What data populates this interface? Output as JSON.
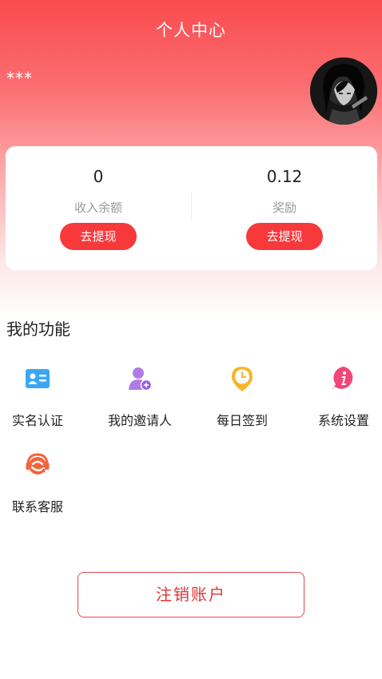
{
  "header": {
    "title": "个人中心",
    "username": "***"
  },
  "balance": {
    "income": {
      "value": "0",
      "label": "收入余额",
      "button": "去提现"
    },
    "reward": {
      "value": "0.12",
      "label": "奖励",
      "button": "去提现"
    }
  },
  "functions": {
    "section_title": "我的功能",
    "items": [
      {
        "label": "实名认证",
        "icon": "id-card-icon",
        "color": "#3aa7f5"
      },
      {
        "label": "我的邀请人",
        "icon": "inviter-icon",
        "color": "#b07be6"
      },
      {
        "label": "每日签到",
        "icon": "clock-pin-icon",
        "color": "#f6b52a"
      },
      {
        "label": "系统设置",
        "icon": "info-bubble-icon",
        "color": "#f2457a"
      },
      {
        "label": "联系客服",
        "icon": "headset-icon",
        "color": "#f4643a"
      }
    ]
  },
  "logout_label": "注销账户",
  "colors": {
    "primary": "#f7393c",
    "header_top": "#f94b4f"
  }
}
